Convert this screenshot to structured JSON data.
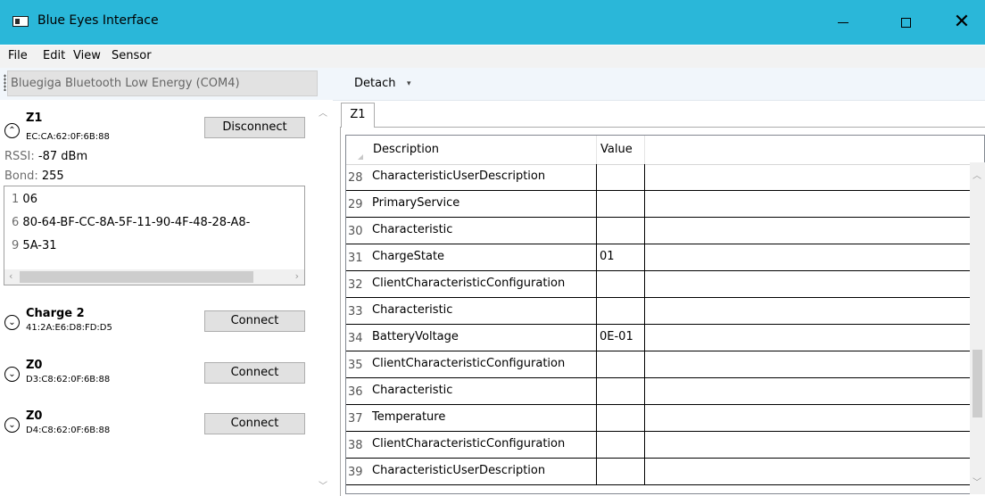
{
  "window": {
    "title": "Blue Eyes Interface"
  },
  "menu": [
    "File",
    "Edit",
    "View",
    "Sensor"
  ],
  "toolbar": {
    "adapter": "Bluegiga Bluetooth Low Energy (COM4)",
    "detach_label": "Detach"
  },
  "connected_device": {
    "name": "Z1",
    "address": "EC:CA:62:0F:6B:88",
    "button_label": "Disconnect",
    "rssi_label": "RSSI:",
    "rssi_value": "-87",
    "rssi_unit": "dBm",
    "bond_label": "Bond:",
    "bond_value": "255",
    "adv_data": [
      {
        "num": "1",
        "value": "06"
      },
      {
        "num": "6",
        "value": "80-64-BF-CC-8A-5F-11-90-4F-48-28-A8-"
      },
      {
        "num": "9",
        "value": "5A-31"
      }
    ]
  },
  "devices": [
    {
      "name": "Charge 2",
      "address": "41:2A:E6:D8:FD:D5",
      "button_label": "Connect"
    },
    {
      "name": "Z0",
      "address": "D3:C8:62:0F:6B:88",
      "button_label": "Connect"
    },
    {
      "name": "Z0",
      "address": "D4:C8:62:0F:6B:88",
      "button_label": "Connect"
    }
  ],
  "tabs": [
    {
      "label": "Z1"
    }
  ],
  "grid": {
    "columns": [
      "Description",
      "Value"
    ],
    "rows": [
      {
        "num": "28",
        "description": "CharacteristicUserDescription",
        "value": ""
      },
      {
        "num": "29",
        "description": "PrimaryService",
        "value": ""
      },
      {
        "num": "30",
        "description": "Characteristic",
        "value": ""
      },
      {
        "num": "31",
        "description": "ChargeState",
        "value": "01"
      },
      {
        "num": "32",
        "description": "ClientCharacteristicConfiguration",
        "value": ""
      },
      {
        "num": "33",
        "description": "Characteristic",
        "value": ""
      },
      {
        "num": "34",
        "description": "BatteryVoltage",
        "value": "0E-01"
      },
      {
        "num": "35",
        "description": "ClientCharacteristicConfiguration",
        "value": ""
      },
      {
        "num": "36",
        "description": "Characteristic",
        "value": ""
      },
      {
        "num": "37",
        "description": "Temperature",
        "value": ""
      },
      {
        "num": "38",
        "description": "ClientCharacteristicConfiguration",
        "value": ""
      },
      {
        "num": "39",
        "description": "CharacteristicUserDescription",
        "value": ""
      }
    ]
  },
  "colors": {
    "titlebar": "#2ab7d9",
    "toolbar": "#f1f6fb"
  }
}
